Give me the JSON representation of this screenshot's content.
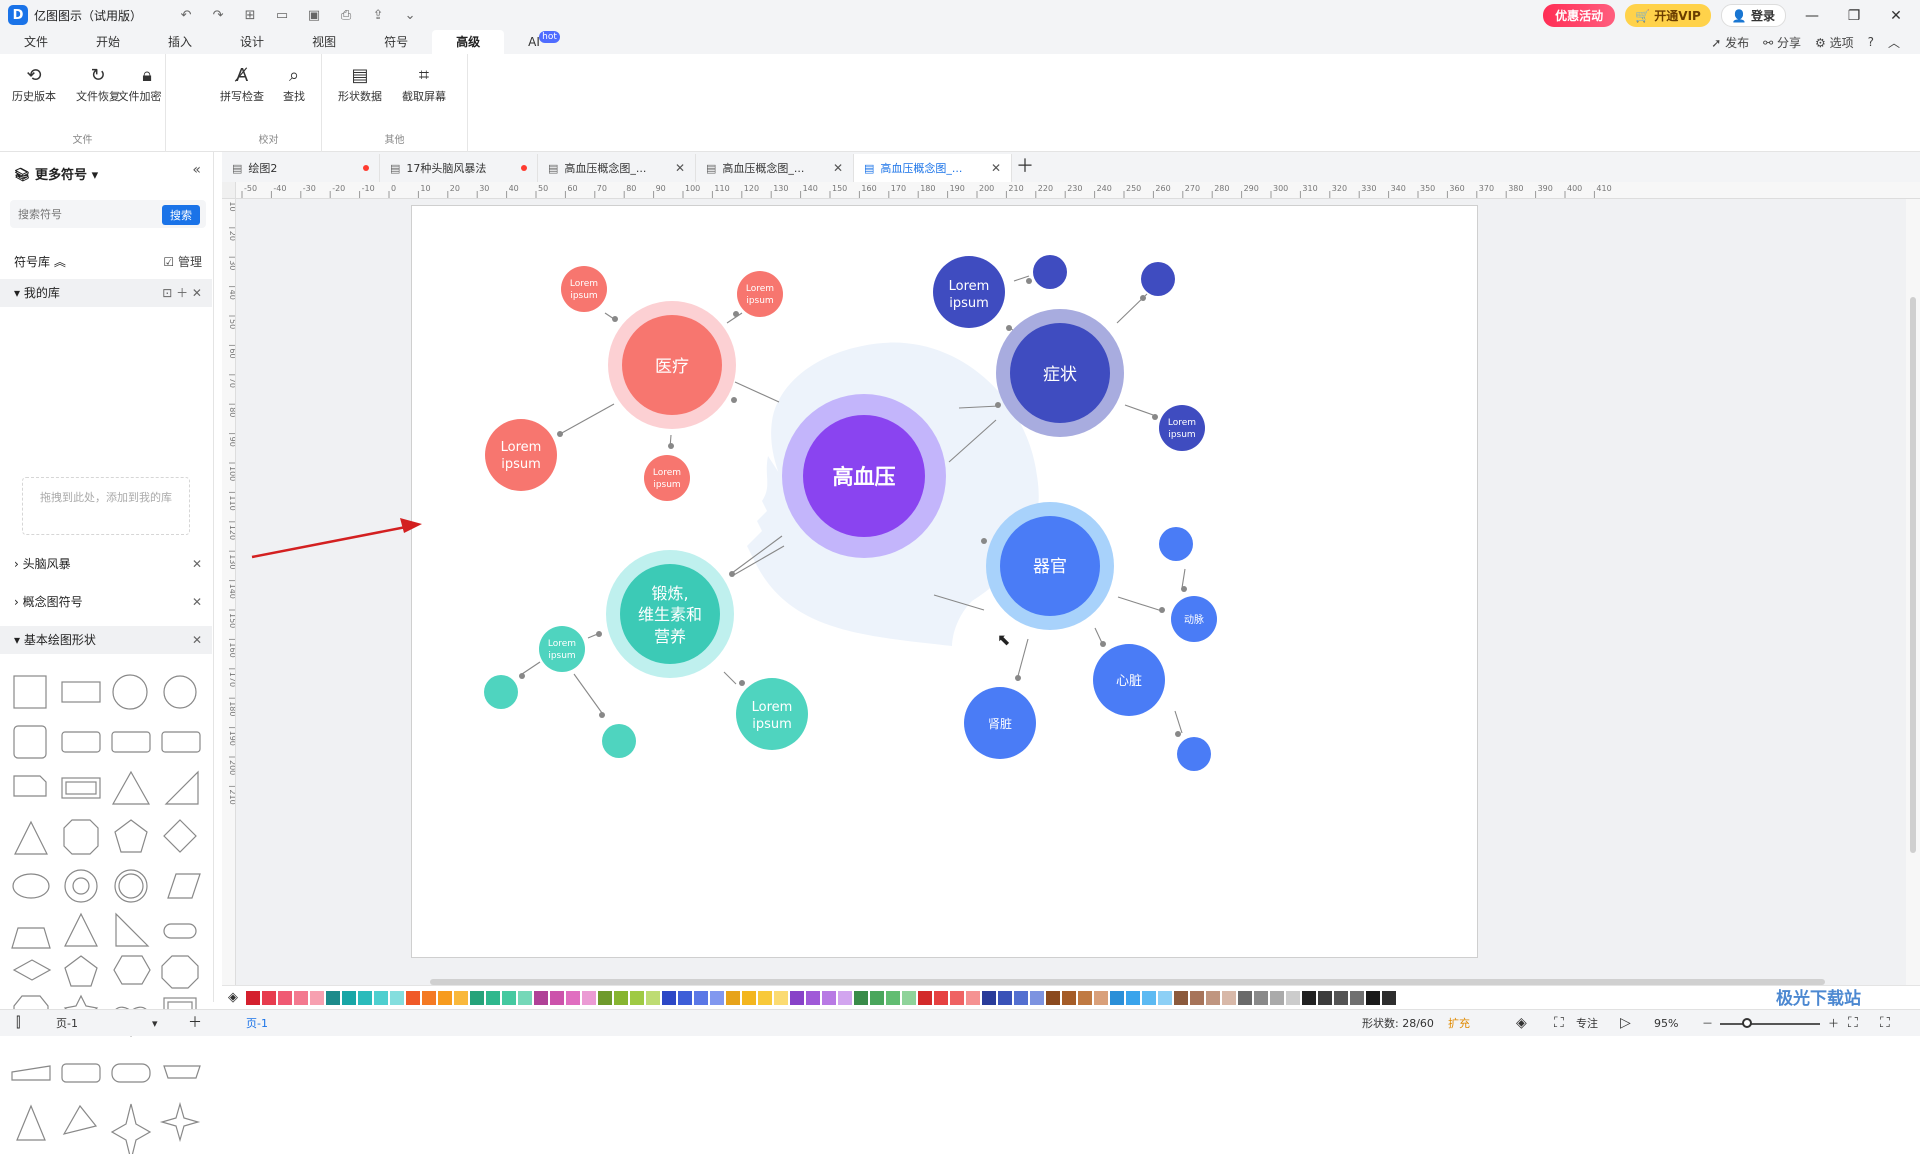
{
  "app": {
    "title": "亿图图示（试用版）"
  },
  "titlebar": {
    "promo": "优惠活动",
    "vip": "开通VIP",
    "login": "登录"
  },
  "menus": [
    "文件",
    "开始",
    "插入",
    "设计",
    "视图",
    "符号",
    "高级",
    "AI"
  ],
  "menu_hot": "hot",
  "menu_right": {
    "publish": "发布",
    "share": "分享",
    "options": "选项",
    "help": "?"
  },
  "ribbon": {
    "groups": [
      {
        "name": "文件",
        "buttons": [
          {
            "label": "历史版本",
            "icon": "history-icon"
          },
          {
            "label": "文件恢复",
            "icon": "restore-icon"
          },
          {
            "label": "文件加密",
            "icon": "lock-icon"
          }
        ]
      },
      {
        "name": "校对",
        "buttons": [
          {
            "label": "拼写检查",
            "icon": "spellcheck-icon"
          },
          {
            "label": "查找",
            "icon": "find-icon"
          }
        ]
      },
      {
        "name": "其他",
        "buttons": [
          {
            "label": "形状数据",
            "icon": "shape-data-icon"
          },
          {
            "label": "截取屏幕",
            "icon": "crop-icon"
          }
        ]
      }
    ]
  },
  "leftpanel": {
    "title": "更多符号",
    "search_placeholder": "搜索符号",
    "search_btn": "搜索",
    "library_label": "符号库",
    "manage": "管理",
    "my_lib": "我的库",
    "drop_hint": "拖拽到此处，添加到我的库",
    "libs": [
      "头脑风暴",
      "概念图符号",
      "基本绘图形状"
    ]
  },
  "tabs": [
    {
      "label": "绘图2",
      "state": "unsaved"
    },
    {
      "label": "17种头脑风暴法",
      "state": "unsaved"
    },
    {
      "label": "高血压概念图_...",
      "state": "close"
    },
    {
      "label": "高血压概念图_...",
      "state": "close"
    },
    {
      "label": "高血压概念图_...",
      "state": "active"
    }
  ],
  "ruler": {
    "h": [
      "-50",
      "-40",
      "-30",
      "-20",
      "-10",
      "0",
      "10",
      "20",
      "30",
      "40",
      "50",
      "60",
      "70",
      "80",
      "90",
      "100",
      "110",
      "120",
      "130",
      "140",
      "150",
      "160",
      "170",
      "180",
      "190",
      "200",
      "210",
      "220",
      "230",
      "240",
      "250",
      "260",
      "270",
      "280",
      "290",
      "300",
      "310",
      "320",
      "330",
      "340",
      "350",
      "360",
      "370",
      "380",
      "390",
      "400",
      "410"
    ],
    "v": [
      "0",
      "10",
      "20",
      "30",
      "40",
      "50",
      "60",
      "70",
      "80",
      "90",
      "100",
      "110",
      "120",
      "130",
      "140",
      "150",
      "160",
      "170",
      "180",
      "190",
      "200",
      "210"
    ]
  },
  "diagram": {
    "center": "高血压",
    "nodes": {
      "medical": "医疗",
      "symptom": "症状",
      "organ": "器官",
      "exercise": "锻炼,维生素和营养",
      "lorem": "Lorem ipsum",
      "artery": "动脉",
      "heart": "心脏",
      "kidney": "肾脏"
    },
    "colors": {
      "red": "#f7766f",
      "blue_dark": "#3f4cc0",
      "blue": "#4a7cf6",
      "teal": "#4fd4bf",
      "purple": "#8a44f0"
    }
  },
  "palette": [
    "#d4202e",
    "#e73c4e",
    "#f05a73",
    "#f3798f",
    "#f7a0b0",
    "#1d8b8b",
    "#19a6a6",
    "#2bbbbb",
    "#4fcfcf",
    "#84dede",
    "#f05a28",
    "#f47a24",
    "#f79b1e",
    "#f9b83c",
    "#26a37a",
    "#2fb88d",
    "#45c9a0",
    "#75d8b8",
    "#b04297",
    "#cc53ab",
    "#e06ec0",
    "#eb9bd4",
    "#6e9a2c",
    "#87b531",
    "#9fca44",
    "#bedc73",
    "#2d48c6",
    "#3e5ed8",
    "#5b78e6",
    "#8198ef",
    "#e7a31a",
    "#f3b61f",
    "#f8c93a",
    "#fbdb72",
    "#8842c8",
    "#a05ad8",
    "#b87ae4",
    "#d2a5ef",
    "#3a8c4a",
    "#4aa65c",
    "#62bd72",
    "#8fd39a",
    "#d32a2a",
    "#e64141",
    "#ef6363",
    "#f59292",
    "#2a3c9a",
    "#3a52b8",
    "#5470d0",
    "#7d93e0",
    "#8b4a1e",
    "#a55d28",
    "#c07a42",
    "#d9a07a",
    "#2b8fd8",
    "#3aa4ec",
    "#5dbaf2",
    "#8dd0f6",
    "#8c5a3c",
    "#a7745a",
    "#c09680",
    "#d8b8a8",
    "#6a6a6a",
    "#8a8a8a",
    "#aaaaaa",
    "#cccccc",
    "#222222",
    "#3c3c3c",
    "#555555",
    "#707070",
    "#1a1a1a",
    "#2e2e2e"
  ],
  "status": {
    "page_left": "页-1",
    "page_tab": "页-1",
    "shape_count": "形状数: 28/60",
    "expand": "扩充",
    "focus": "专注",
    "zoom": "95%"
  },
  "watermark": "极光下载站"
}
